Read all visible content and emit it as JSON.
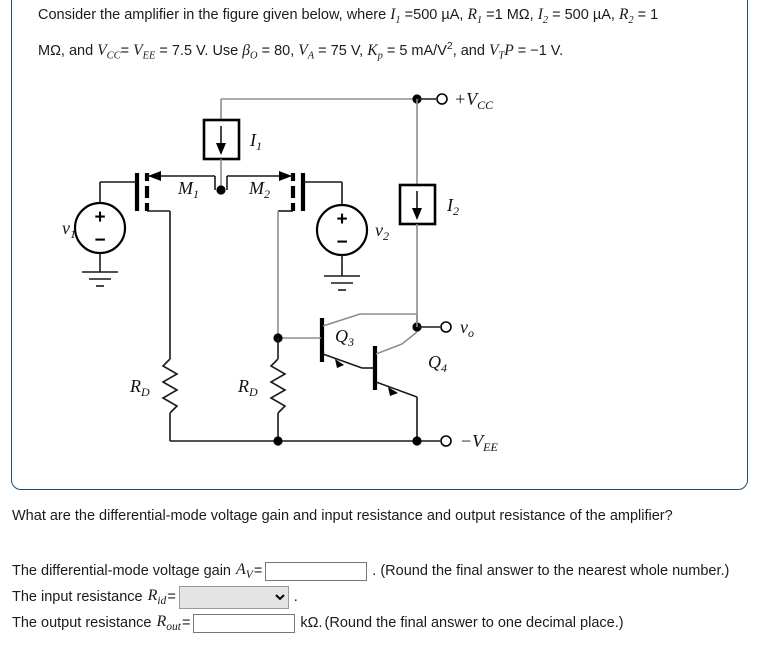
{
  "question": {
    "prompt_parts": {
      "lead": "Consider the amplifier in the figure given below, where",
      "I1_label": "I",
      "I1_sub": "1",
      "I1_value": "=500 µA,",
      "R1_label": "R",
      "R1_sub": "1",
      "R1_value": "=1 MΩ,",
      "I2_label": "I",
      "I2_sub": "2",
      "I2_value": "= 500 µA,",
      "R2_label": "R",
      "R2_sub": "2",
      "R2_value": "= 1 MΩ, and",
      "VCC_label": "V",
      "VCC_sub": "CC",
      "eq1": "=",
      "VEE_label": "V",
      "VEE_sub": "EE",
      "VEE_value": "= 7.5 V. Use",
      "beta_label": "β",
      "beta_sub": "O",
      "beta_value": "= 80,",
      "VA_label": "V",
      "VA_sub": "A",
      "VA_value": "= 75 V,",
      "Kp_label": "K",
      "Kp_sub": "p",
      "Kp_value": "= 5 mA/V",
      "Kp_exp": "2",
      "Kp_tail": ", and",
      "VTP_label": "V",
      "VTP_sub": "T",
      "VTP_p": "P",
      "VTP_value": "= −1 V."
    },
    "followup": "What are the differential-mode voltage gain and input resistance and output resistance of the amplifier?"
  },
  "circuit": {
    "labels": {
      "vcc": "+V",
      "vcc_sub": "CC",
      "vee": "−V",
      "vee_sub": "EE",
      "vo": "v",
      "vo_sub": "o",
      "v1": "v",
      "v1_sub": "1",
      "v2": "v",
      "v2_sub": "2",
      "i1": "I",
      "i1_sub": "1",
      "i2": "I",
      "i2_sub": "2",
      "m1": "M",
      "m1_sub": "1",
      "m2": "M",
      "m2_sub": "2",
      "q3": "Q",
      "q3_sub": "3",
      "q4": "Q",
      "q4_sub": "4",
      "rd_left": "R",
      "rd_left_sub": "D",
      "rd_right": "R",
      "rd_right_sub": "D",
      "source_plus": "+",
      "source_minus": "−"
    },
    "colors": {
      "wire": "#1a1a1a",
      "wire_light": "#8a8a8a",
      "card_border": "#1f4e79"
    }
  },
  "answers": {
    "gain": {
      "label_pre": "The differential-mode voltage gain",
      "symbol": "A",
      "symbol_sub": "V",
      "equals": "=",
      "value": "",
      "trailing": ". (Round the final answer to the nearest whole number.)"
    },
    "input_resistance": {
      "label_pre": "The input resistance",
      "symbol": "R",
      "symbol_sub": "id",
      "equals": "=",
      "value": "",
      "options": [
        ""
      ],
      "trailing": "."
    },
    "output_resistance": {
      "label_pre": "The output resistance",
      "symbol": "R",
      "symbol_sub": "out",
      "equals": "=",
      "value": "",
      "unit": "kΩ.",
      "trailing": "(Round the final answer to one decimal place.)"
    }
  }
}
